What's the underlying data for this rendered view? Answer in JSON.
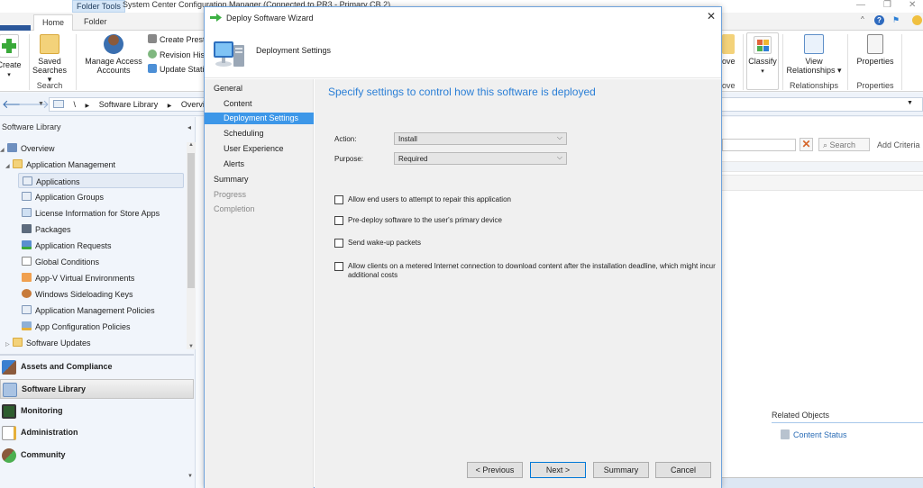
{
  "window": {
    "title": "System Center Configuration Manager (Connected to PR3 - Primary CB 2)",
    "contextual_tab": "Folder Tools",
    "controls": {
      "minimize": "—",
      "restore": "❐",
      "close": "✕"
    }
  },
  "ribbon": {
    "tabs": [
      {
        "label": "Home",
        "active": true
      },
      {
        "label": "Folder",
        "active": false
      }
    ],
    "buttons": {
      "create": "Create",
      "saved_searches": "Saved Searches ▾",
      "manage_access": "Manage Access Accounts",
      "create_prestaged": "Create Prest",
      "revision_history": "Revision His",
      "update_statistics": "Update Stati",
      "move": "ove",
      "classify": "Classify",
      "view_relationships": "View Relationships ▾",
      "properties": "Properties"
    },
    "groups": {
      "search": "Search",
      "move": "ove",
      "relationships": "Relationships",
      "properties": "Properties"
    }
  },
  "address_bar": {
    "root": "\\",
    "crumbs": [
      "Software Library",
      "Overvie"
    ]
  },
  "nav_pane": {
    "header": "Software Library",
    "tree": [
      {
        "label": "Overview",
        "level": 0,
        "icon": "overview-icon"
      },
      {
        "label": "Application Management",
        "level": 1,
        "icon": "folder-icon"
      },
      {
        "label": "Applications",
        "level": 2,
        "icon": "applications-icon",
        "selected": true
      },
      {
        "label": "Application Groups",
        "level": 2,
        "icon": "application-groups-icon"
      },
      {
        "label": "License Information for Store Apps",
        "level": 2,
        "icon": "license-icon"
      },
      {
        "label": "Packages",
        "level": 2,
        "icon": "packages-icon"
      },
      {
        "label": "Application Requests",
        "level": 2,
        "icon": "requests-icon"
      },
      {
        "label": "Global Conditions",
        "level": 2,
        "icon": "conditions-icon"
      },
      {
        "label": "App-V Virtual Environments",
        "level": 2,
        "icon": "appv-icon"
      },
      {
        "label": "Windows Sideloading Keys",
        "level": 2,
        "icon": "keys-icon"
      },
      {
        "label": "Application Management Policies",
        "level": 2,
        "icon": "policies-icon"
      },
      {
        "label": "App Configuration Policies",
        "level": 2,
        "icon": "config-policies-icon"
      },
      {
        "label": "Software Updates",
        "level": 1,
        "icon": "folder-icon"
      }
    ],
    "workspaces": [
      {
        "label": "Assets and Compliance",
        "active": false
      },
      {
        "label": "Software Library",
        "active": true
      },
      {
        "label": "Monitoring",
        "active": false
      },
      {
        "label": "Administration",
        "active": false
      },
      {
        "label": "Community",
        "active": false
      }
    ]
  },
  "content": {
    "search_button": "Search",
    "add_criteria": "Add Criteria",
    "related_objects_title": "Related Objects",
    "related_link": "Content Status"
  },
  "dialog": {
    "title": "Deploy Software Wizard",
    "header_title": "Deployment Settings",
    "nav": [
      {
        "label": "General",
        "sub": false,
        "state": "normal"
      },
      {
        "label": "Content",
        "sub": true,
        "state": "normal"
      },
      {
        "label": "Deployment Settings",
        "sub": true,
        "state": "active"
      },
      {
        "label": "Scheduling",
        "sub": true,
        "state": "normal"
      },
      {
        "label": "User Experience",
        "sub": true,
        "state": "normal"
      },
      {
        "label": "Alerts",
        "sub": true,
        "state": "normal"
      },
      {
        "label": "Summary",
        "sub": false,
        "state": "normal"
      },
      {
        "label": "Progress",
        "sub": false,
        "state": "disabled"
      },
      {
        "label": "Completion",
        "sub": false,
        "state": "disabled"
      }
    ],
    "heading": "Specify settings to control how this software is deployed",
    "fields": {
      "action_label": "Action:",
      "action_value": "Install",
      "purpose_label": "Purpose:",
      "purpose_value": "Required"
    },
    "checkboxes": [
      {
        "label": "Allow end users to attempt to repair this application",
        "checked": false
      },
      {
        "label": "Pre-deploy software to the user's primary device",
        "checked": false
      },
      {
        "label": "Send wake-up packets",
        "checked": false
      },
      {
        "label": "Allow clients on a metered Internet connection to download content after the installation deadline, which might incur additional costs",
        "checked": false
      }
    ],
    "buttons": {
      "previous": "< Previous",
      "next": "Next >",
      "summary": "Summary",
      "cancel": "Cancel"
    }
  }
}
